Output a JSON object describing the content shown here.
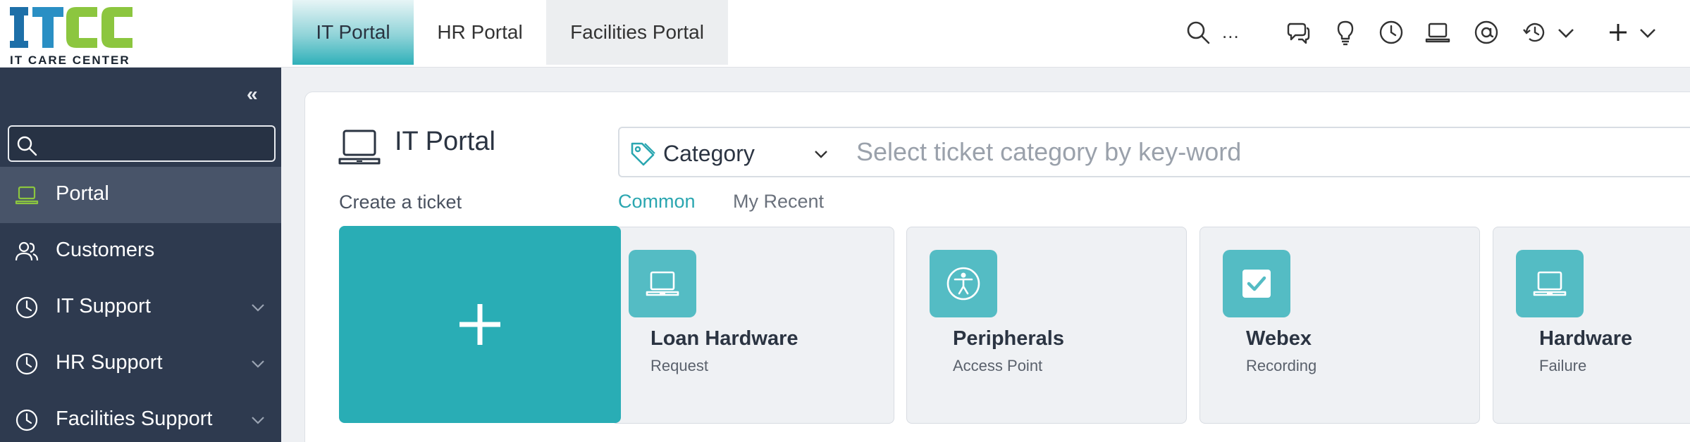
{
  "logo": {
    "letters": "ITCC",
    "subtitle": "IT CARE CENTER"
  },
  "tabs": [
    {
      "label": "IT Portal",
      "active": true
    },
    {
      "label": "HR Portal",
      "active": false
    },
    {
      "label": "Facilities Portal",
      "active": false
    }
  ],
  "topbar": {
    "search_text": "...",
    "icons": [
      "search-icon",
      "chat-icon",
      "lightbulb-icon",
      "clock-icon",
      "laptop-icon",
      "at-icon",
      "history-icon",
      "chevron-down-icon",
      "plus-icon",
      "chevron-down-icon"
    ]
  },
  "sidebar": {
    "collapse_label": "‹‹",
    "search_placeholder": "",
    "items": [
      {
        "label": "Portal",
        "icon": "laptop-icon",
        "active": true,
        "expandable": false
      },
      {
        "label": "Customers",
        "icon": "users-icon",
        "active": false,
        "expandable": false
      },
      {
        "label": "IT Support",
        "icon": "clock-icon",
        "active": false,
        "expandable": true
      },
      {
        "label": "HR Support",
        "icon": "clock-icon",
        "active": false,
        "expandable": true
      },
      {
        "label": "Facilities Support",
        "icon": "clock-icon",
        "active": false,
        "expandable": true
      }
    ]
  },
  "main": {
    "title": "IT Portal",
    "create_label": "Create a ticket",
    "category": {
      "label": "Category",
      "placeholder": "Select ticket category by key-word"
    },
    "subtabs": [
      {
        "label": "Common",
        "active": true
      },
      {
        "label": "My Recent",
        "active": false
      }
    ],
    "tiles": [
      {
        "title": "Loan Hardware",
        "subtitle": "Request",
        "icon": "laptop-icon"
      },
      {
        "title": "Peripherals",
        "subtitle": "Access Point",
        "icon": "accessibility-icon"
      },
      {
        "title": "Webex",
        "subtitle": "Recording",
        "icon": "checkbox-icon"
      },
      {
        "title": "Hardware",
        "subtitle": "Failure",
        "icon": "laptop-icon"
      }
    ]
  },
  "colors": {
    "accent": "#29adb5",
    "sidebar_bg": "#2e3a4f",
    "sidebar_active": "#485469",
    "logo_blue": "#1d6fa8",
    "logo_green": "#8cc63f",
    "tile_icon_bg": "#54bcc4"
  }
}
